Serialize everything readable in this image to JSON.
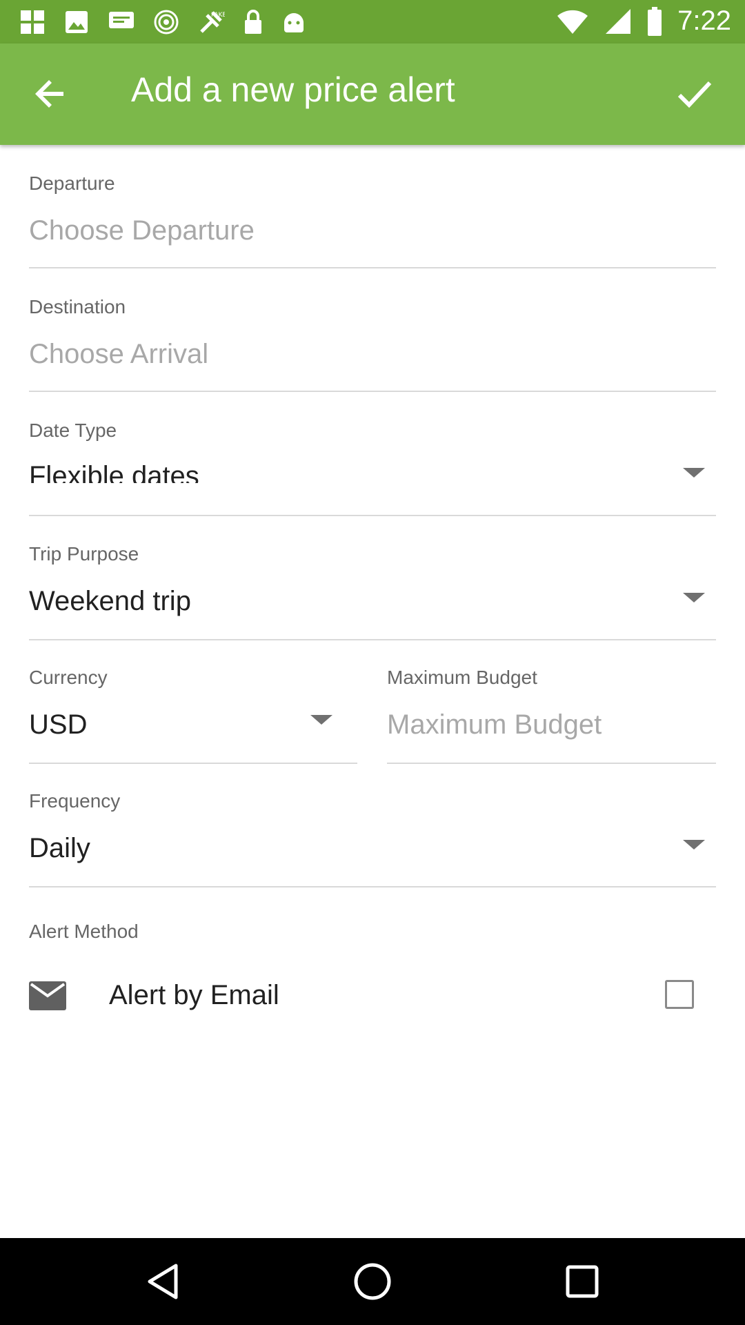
{
  "status_bar": {
    "time": "7:22",
    "icons": [
      "app-icon",
      "photo-icon",
      "message-icon",
      "hotspot-icon",
      "fake-gps-icon",
      "lock-icon",
      "android-icon",
      "wifi-icon",
      "signal-icon",
      "battery-icon"
    ]
  },
  "app_bar": {
    "title": "Add a new price alert",
    "back_icon": "arrow-left-icon",
    "confirm_icon": "checkmark-icon"
  },
  "form": {
    "departure": {
      "label": "Departure",
      "placeholder": "Choose Departure"
    },
    "destination": {
      "label": "Destination",
      "placeholder": "Choose Arrival"
    },
    "date_type": {
      "label": "Date Type",
      "value": "Flexible dates"
    },
    "trip_purpose": {
      "label": "Trip Purpose",
      "value": "Weekend trip"
    },
    "currency": {
      "label": "Currency",
      "value": "USD"
    },
    "max_budget": {
      "label": "Maximum Budget",
      "placeholder": "Maximum Budget"
    },
    "frequency": {
      "label": "Frequency",
      "value": "Daily"
    },
    "alert_method": {
      "label": "Alert Method",
      "email": {
        "label": "Alert by Email",
        "checked": false,
        "icon": "email-icon"
      }
    }
  },
  "colors": {
    "status_bar": "#6aa534",
    "app_bar": "#7cb84a",
    "text_primary": "#212121",
    "text_secondary": "#666666",
    "placeholder": "#a8a8a8"
  },
  "nav_bar": {
    "icons": [
      "back-triangle-icon",
      "home-circle-icon",
      "recents-square-icon"
    ]
  }
}
